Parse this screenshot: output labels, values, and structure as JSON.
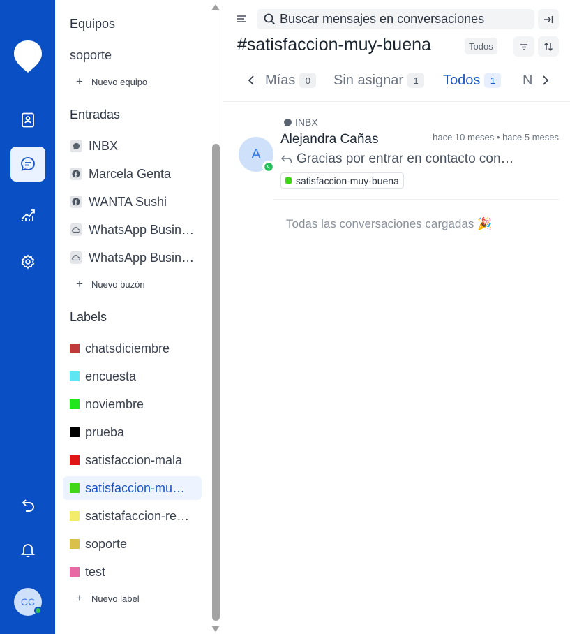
{
  "colors": {
    "rail": "#0b4fc4",
    "accent": "#1a56c5",
    "online": "#33c15a"
  },
  "rail": {
    "logo_icon": "chat-bubble-pin-logo",
    "items": [
      {
        "icon": "contacts-icon"
      },
      {
        "icon": "conversations-icon",
        "active": true
      },
      {
        "icon": "reports-icon"
      },
      {
        "icon": "settings-icon"
      }
    ],
    "bottom": [
      {
        "icon": "undo-icon"
      },
      {
        "icon": "bell-icon"
      }
    ],
    "avatar_initials": "CC"
  },
  "sidebar": {
    "teams_heading": "Equipos",
    "teams": [
      "soporte"
    ],
    "new_team": "Nuevo equipo",
    "inboxes_heading": "Entradas",
    "inboxes": [
      {
        "label": "INBX",
        "icon": "chat-icon"
      },
      {
        "label": "Marcela Genta",
        "icon": "facebook-icon"
      },
      {
        "label": "WANTA Sushi",
        "icon": "facebook-icon"
      },
      {
        "label": "WhatsApp Business",
        "icon": "cloud-icon"
      },
      {
        "label": "WhatsApp Business",
        "icon": "cloud-icon"
      }
    ],
    "new_inbox": "Nuevo buzón",
    "labels_heading": "Labels",
    "labels": [
      {
        "label": "chatsdiciembre",
        "color": "#c0393b"
      },
      {
        "label": "encuesta",
        "color": "#5ee7f2"
      },
      {
        "label": "noviembre",
        "color": "#22e61c"
      },
      {
        "label": "prueba",
        "color": "#000000"
      },
      {
        "label": "satisfaccion-mala",
        "color": "#e01515"
      },
      {
        "label": "satisfaccion-muy-buena",
        "color": "#41d617",
        "active": true
      },
      {
        "label": "satistafaccion-regular",
        "color": "#f2ec6a"
      },
      {
        "label": "soporte",
        "color": "#d9c04a"
      },
      {
        "label": "test",
        "color": "#e86aa5"
      }
    ],
    "new_label": "Nuevo label"
  },
  "header": {
    "search_placeholder": "Buscar mensajes en conversaciones",
    "title": "#satisfaccion-muy-buena",
    "status": "Todos"
  },
  "tabs": [
    {
      "label": "Mías",
      "count": "0"
    },
    {
      "label": "Sin asignar",
      "count": "1"
    },
    {
      "label": "Todos",
      "count": "1",
      "active": true
    },
    {
      "label": "N"
    }
  ],
  "conversation": {
    "inbox": "INBX",
    "avatar_initial": "A",
    "name": "Alejandra Cañas",
    "time": "hace 10 meses • hace 5 meses",
    "message": "Gracias por entrar en contacto con ellos",
    "tag": "satisfaccion-muy-buena",
    "tag_color": "#41d617"
  },
  "footer_text": "Todas las conversaciones cargadas 🎉"
}
